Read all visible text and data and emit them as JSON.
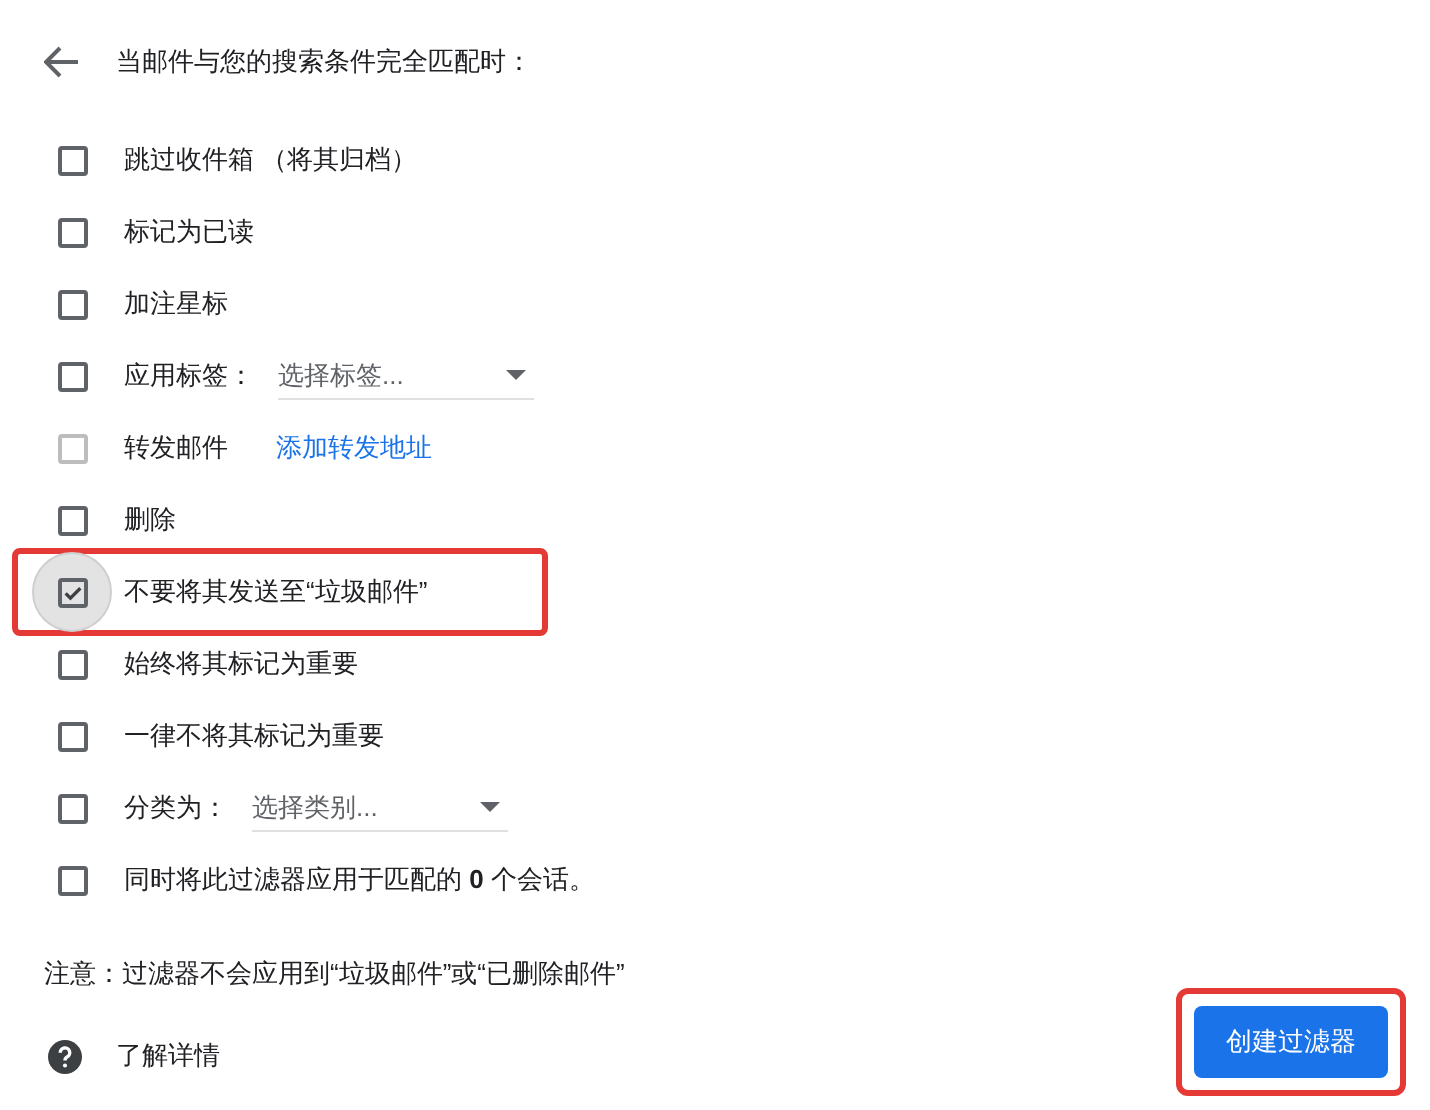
{
  "header": {
    "title": "当邮件与您的搜索条件完全匹配时："
  },
  "options": [
    {
      "kind": "plain",
      "label": "跳过收件箱 （将其归档）",
      "checked": false,
      "disabled": false,
      "highlighted": false
    },
    {
      "kind": "plain",
      "label": "标记为已读",
      "checked": false,
      "disabled": false,
      "highlighted": false
    },
    {
      "kind": "plain",
      "label": "加注星标",
      "checked": false,
      "disabled": false,
      "highlighted": false
    },
    {
      "kind": "select",
      "label": "应用标签：",
      "placeholder": "选择标签...",
      "checked": false,
      "disabled": false,
      "highlighted": false
    },
    {
      "kind": "link",
      "label": "转发邮件",
      "link": "添加转发地址",
      "checked": false,
      "disabled": true,
      "highlighted": false
    },
    {
      "kind": "plain",
      "label": "删除",
      "checked": false,
      "disabled": false,
      "highlighted": false
    },
    {
      "kind": "plain",
      "label": "不要将其发送至“垃圾邮件”",
      "checked": true,
      "disabled": false,
      "highlighted": true
    },
    {
      "kind": "plain",
      "label": "始终将其标记为重要",
      "checked": false,
      "disabled": false,
      "highlighted": false
    },
    {
      "kind": "plain",
      "label": "一律不将其标记为重要",
      "checked": false,
      "disabled": false,
      "highlighted": false
    },
    {
      "kind": "select",
      "label": "分类为：",
      "placeholder": "选择类别...",
      "checked": false,
      "disabled": false,
      "highlighted": false
    },
    {
      "kind": "plain",
      "label": "同时将此过滤器应用于匹配的 **0** 个会话。",
      "checked": false,
      "disabled": false,
      "highlighted": false
    }
  ],
  "note": "注意：过滤器不会应用到“垃圾邮件”或“已删除邮件”",
  "learn_more": "了解详情",
  "create_button": {
    "label": "创建过滤器",
    "highlighted": true
  }
}
